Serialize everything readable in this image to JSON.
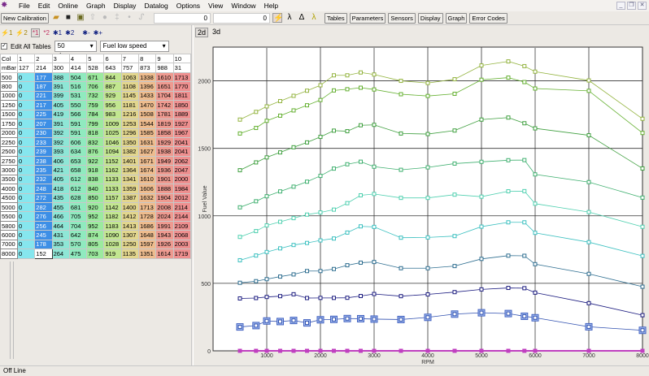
{
  "menu": [
    "File",
    "Edit",
    "Online",
    "Graph",
    "Display",
    "Datalog",
    "Options",
    "View",
    "Window",
    "Help"
  ],
  "toolbar": {
    "new_calibration": "New Calibration",
    "field1": "0",
    "field2": "0",
    "buttons": [
      "Tables",
      "Parameters",
      "Sensors",
      "Display",
      "Graph",
      "Error Codes"
    ]
  },
  "icon_row": [
    "⚡1",
    "⚡2",
    "*1",
    "*2",
    "✱1",
    "✱2",
    "✱-",
    "✱+"
  ],
  "edit_all_label": "Edit All Tables",
  "edit_all_checked": true,
  "temp_select": "50 degrees",
  "table_select": "Fuel low speed",
  "view_tabs": [
    "2d",
    "3d"
  ],
  "table": {
    "col_label": "Col",
    "mbar_label": "mBar",
    "cols": [
      "1",
      "2",
      "3",
      "4",
      "5",
      "6",
      "7",
      "8",
      "9",
      "10"
    ],
    "mbar": [
      "127",
      "214",
      "300",
      "414",
      "528",
      "643",
      "757",
      "873",
      "988",
      "31"
    ],
    "rows": [
      {
        "rpm": "500",
        "v": [
          0,
          177,
          388,
          504,
          671,
          844,
          1063,
          1338,
          1610,
          1713
        ]
      },
      {
        "rpm": "800",
        "v": [
          0,
          187,
          391,
          516,
          706,
          887,
          1108,
          1396,
          1651,
          1770
        ]
      },
      {
        "rpm": "1000",
        "v": [
          0,
          221,
          399,
          531,
          732,
          929,
          1145,
          1433,
          1704,
          1811
        ]
      },
      {
        "rpm": "1250",
        "v": [
          0,
          217,
          405,
          550,
          759,
          956,
          1181,
          1470,
          1742,
          1850
        ]
      },
      {
        "rpm": "1500",
        "v": [
          0,
          225,
          419,
          566,
          784,
          983,
          1216,
          1508,
          1781,
          1889
        ]
      },
      {
        "rpm": "1750",
        "v": [
          0,
          207,
          391,
          591,
          799,
          1009,
          1253,
          1544,
          1819,
          1927
        ]
      },
      {
        "rpm": "2000",
        "v": [
          0,
          230,
          392,
          591,
          818,
          1025,
          1296,
          1585,
          1858,
          1967
        ]
      },
      {
        "rpm": "2250",
        "v": [
          0,
          233,
          392,
          606,
          832,
          1046,
          1350,
          1631,
          1929,
          2041
        ]
      },
      {
        "rpm": "2500",
        "v": [
          0,
          239,
          393,
          634,
          876,
          1094,
          1382,
          1627,
          1938,
          2041
        ]
      },
      {
        "rpm": "2750",
        "v": [
          0,
          238,
          406,
          653,
          922,
          1152,
          1401,
          1671,
          1949,
          2062
        ]
      },
      {
        "rpm": "3000",
        "v": [
          0,
          235,
          421,
          658,
          918,
          1162,
          1364,
          1674,
          1936,
          2047
        ]
      },
      {
        "rpm": "3500",
        "v": [
          0,
          232,
          405,
          612,
          838,
          1133,
          1341,
          1610,
          1901,
          2000
        ]
      },
      {
        "rpm": "4000",
        "v": [
          0,
          248,
          418,
          612,
          840,
          1133,
          1359,
          1606,
          1888,
          1984
        ]
      },
      {
        "rpm": "4500",
        "v": [
          0,
          272,
          435,
          628,
          850,
          1157,
          1387,
          1632,
          1904,
          2012
        ]
      },
      {
        "rpm": "5000",
        "v": [
          0,
          282,
          455,
          681,
          920,
          1142,
          1400,
          1713,
          2008,
          2114
        ]
      },
      {
        "rpm": "5500",
        "v": [
          0,
          276,
          466,
          705,
          952,
          1182,
          1412,
          1728,
          2024,
          2144
        ]
      },
      {
        "rpm": "5800",
        "v": [
          0,
          256,
          464,
          704,
          952,
          1183,
          1413,
          1686,
          1991,
          2109
        ]
      },
      {
        "rpm": "6000",
        "v": [
          0,
          245,
          431,
          642,
          874,
          1090,
          1307,
          1648,
          1943,
          2068
        ]
      },
      {
        "rpm": "7000",
        "v": [
          0,
          178,
          353,
          570,
          805,
          1028,
          1250,
          1597,
          1926,
          2003
        ]
      },
      {
        "rpm": "8000",
        "v": [
          0,
          152,
          264,
          475,
          703,
          919,
          1135,
          1351,
          1614,
          1719
        ]
      }
    ],
    "selected_col": "2",
    "selected_rpm": "8000",
    "col_colors": [
      "#86e6ee",
      "#3d8fe6",
      "#8ee6d6",
      "#90eabf",
      "#9cea9e",
      "#c2e690",
      "#e2d68e",
      "#eebc8e",
      "#ee9a90",
      "#ee8f8f"
    ]
  },
  "chart_data": {
    "type": "line",
    "xlabel": "RPM",
    "ylabel": "Fuel Value",
    "xlim": [
      0,
      8000
    ],
    "ylim": [
      0,
      2250
    ],
    "xticks": [
      "1000",
      "2000",
      "3000",
      "4000",
      "5000",
      "6000",
      "7000",
      "8000"
    ],
    "yticks": [
      "0",
      "500",
      "1000",
      "1500",
      "2000"
    ],
    "grid": true,
    "x_source": "table.rows.rpm",
    "series_colors": [
      "#c040c0",
      "#3050b0",
      "#1c1c80",
      "#2e6e90",
      "#3cc0c0",
      "#50d0b0",
      "#40b070",
      "#40a040",
      "#64b030",
      "#94b440"
    ]
  },
  "status": "Off Line"
}
